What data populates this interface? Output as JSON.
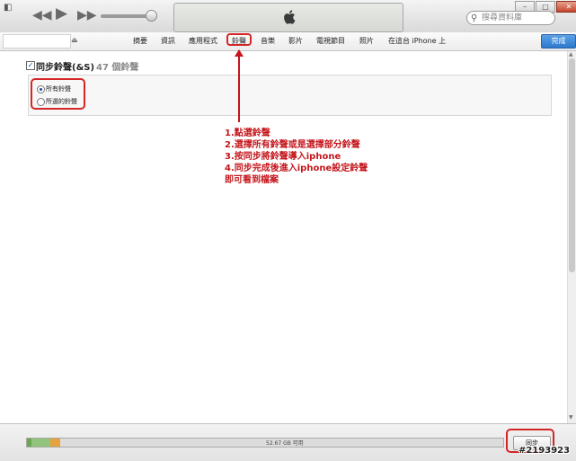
{
  "titlebar": {
    "search_placeholder": "搜尋資料庫",
    "window_buttons": [
      "–",
      "□",
      "✕"
    ]
  },
  "nav": {
    "device_eject": "⏏",
    "tabs": [
      {
        "label": "摘要"
      },
      {
        "label": "資訊"
      },
      {
        "label": "應用程式"
      },
      {
        "label": "鈴聲"
      },
      {
        "label": "音樂"
      },
      {
        "label": "影片"
      },
      {
        "label": "電視節目"
      },
      {
        "label": "照片"
      },
      {
        "label": "在這台 iPhone 上"
      }
    ],
    "selected_tab": "鈴聲",
    "done_label": "完成"
  },
  "ringtones": {
    "sync_title": "同步鈴聲(&S)",
    "count": "47 個鈴聲",
    "options": [
      {
        "label": "所有鈴聲",
        "selected": true
      },
      {
        "label": "所選的鈴聲",
        "selected": false
      }
    ]
  },
  "annotation": {
    "color": "#c4161c",
    "lines": [
      "1.點選鈴聲",
      "2.選擇所有鈴聲或是選擇部分鈴聲",
      "3.按同步將鈴聲導入iphone",
      "4.同步完成後進入iphone設定鈴聲",
      "即可看到檔案"
    ]
  },
  "footer": {
    "capacity_label": "52.67 GB 可用",
    "sync_label": "同步",
    "capacity_segments": [
      {
        "type": "audio",
        "color": "#6aa84f",
        "fraction": 0.01
      },
      {
        "type": "apps",
        "color": "#93c47d",
        "fraction": 0.04
      },
      {
        "type": "other",
        "color": "#e6a23c",
        "fraction": 0.02
      }
    ]
  },
  "watermark": "#2193923",
  "colors": {
    "accent": "#2e78cc",
    "highlight": "#d42626"
  }
}
